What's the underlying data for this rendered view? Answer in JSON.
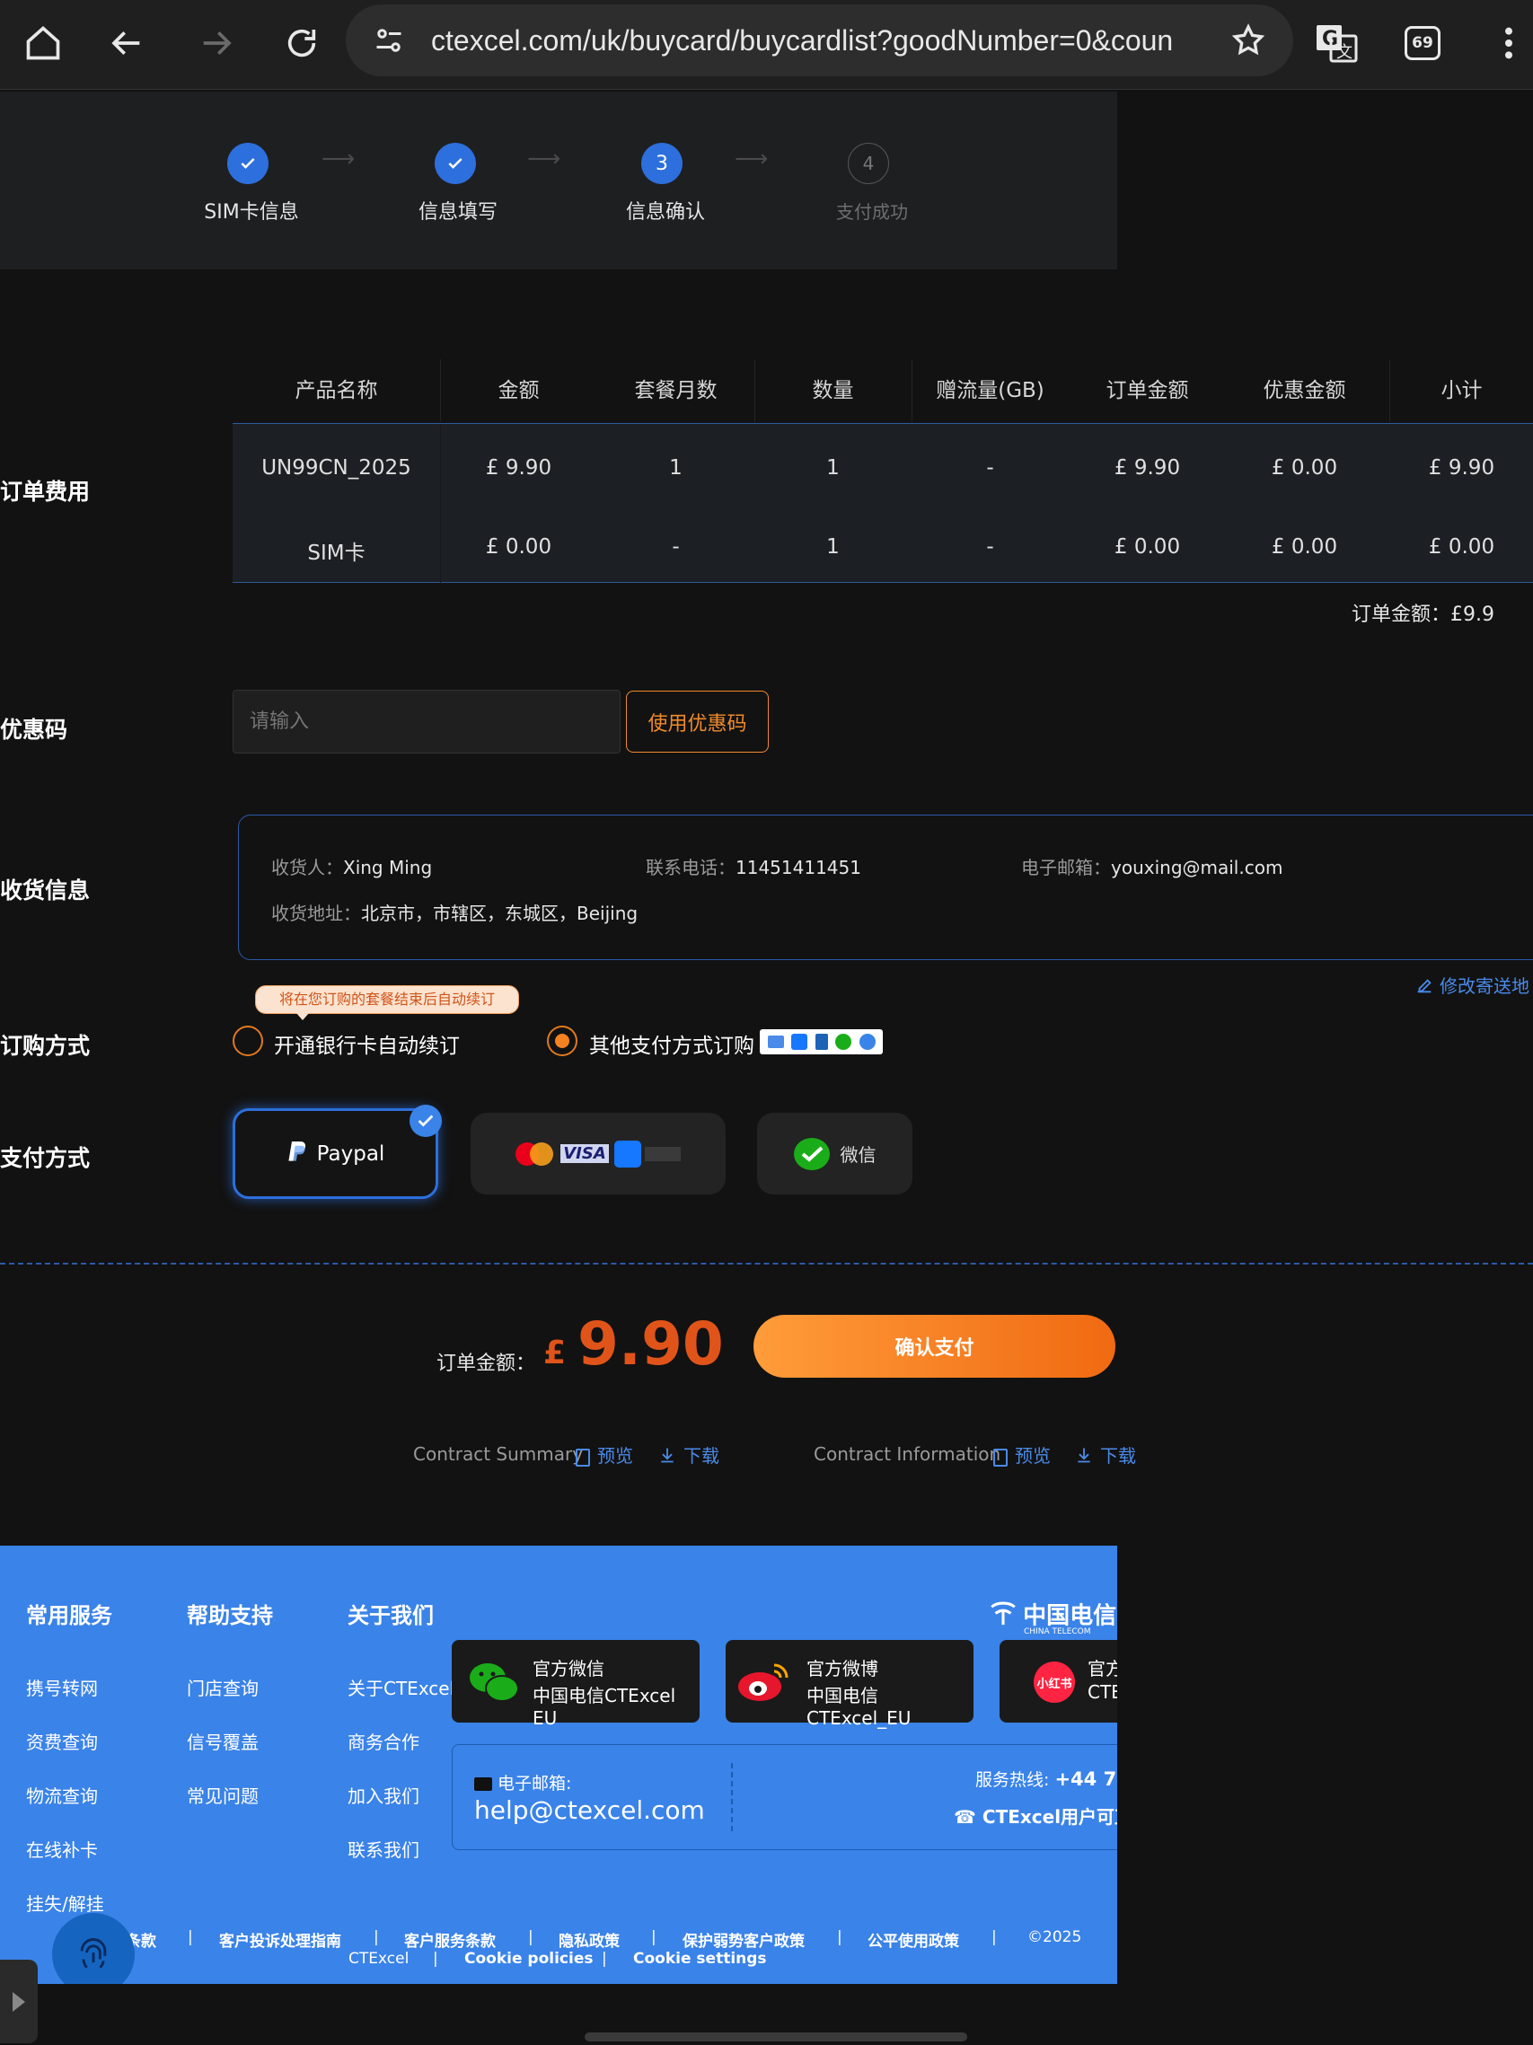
{
  "browser": {
    "url": "ctexcel.com/uk/buycard/buycardlist?goodNumber=0&coun",
    "tab_count": "69"
  },
  "steps": [
    {
      "label": "SIM卡信息",
      "state": "done",
      "num": ""
    },
    {
      "label": "信息填写",
      "state": "done",
      "num": ""
    },
    {
      "label": "信息确认",
      "state": "active",
      "num": "3"
    },
    {
      "label": "支付成功",
      "state": "todo",
      "num": "4"
    }
  ],
  "order": {
    "section_label": "订单费用",
    "headers": [
      "产品名称",
      "金额",
      "套餐月数",
      "数量",
      "赠流量(GB)",
      "订单金额",
      "优惠金额",
      "小计"
    ],
    "rows": [
      [
        "UN99CN_2025",
        "£ 9.90",
        "1",
        "1",
        "-",
        "£ 9.90",
        "£ 0.00",
        "£ 9.90"
      ],
      [
        "SIM卡",
        "£ 0.00",
        "-",
        "1",
        "-",
        "£ 0.00",
        "£ 0.00",
        "£ 0.00"
      ]
    ],
    "total_text": "订单金额：£9.9"
  },
  "coupon": {
    "section_label": "优惠码",
    "placeholder": "请输入",
    "button": "使用优惠码"
  },
  "shipping": {
    "section_label": "收货信息",
    "recipient_label": "收货人：",
    "recipient": "Xing Ming",
    "phone_label": "联系电话：",
    "phone": "11451411451",
    "email_label": "电子邮箱：",
    "email": "youxing@mail.com",
    "address_label": "收货地址：",
    "address": "北京市，市辖区，东城区，Beijing",
    "edit_link": "修改寄送地"
  },
  "subscription": {
    "section_label": "订购方式",
    "tooltip": "将在您订购的套餐结束后自动续订",
    "option1": "开通银行卡自动续订",
    "option2": "其他支付方式订购",
    "selected": "option2"
  },
  "payment": {
    "section_label": "支付方式",
    "methods": [
      "Paypal",
      "card",
      "微信"
    ],
    "selected": "Paypal",
    "mastercard": "MasterCard",
    "visa": "VISA"
  },
  "summary": {
    "total_label": "订单金额：",
    "currency": "£",
    "amount": "9.90",
    "confirm": "确认支付",
    "contract_summary": "Contract Summary",
    "contract_info": "Contract Information",
    "preview": "预览",
    "download": "下载"
  },
  "footer": {
    "col1_title": "常用服务",
    "col1_items": [
      "携号转网",
      "资费查询",
      "物流查询",
      "在线补卡",
      "挂失/解挂"
    ],
    "col2_title": "帮助支持",
    "col2_items": [
      "门店查询",
      "信号覆盖",
      "常见问题"
    ],
    "col3_title": "关于我们",
    "col3_items": [
      "关于CTExcel",
      "商务合作",
      "加入我们",
      "联系我们"
    ],
    "logo": "中国电信",
    "logo_sub": "CHINA TELECOM",
    "wechat_title": "官方微信",
    "wechat_name": "中国电信CTExcel EU",
    "weibo_title": "官方微博",
    "weibo_name": "中国电信CTExcel_EU",
    "xhs_title": "官方",
    "xhs_name": "CTE",
    "xhs_badge": "小红书",
    "email_label": "电子邮箱:",
    "email": "help@ctexcel.com",
    "hotline_label": "服务热线:",
    "hotline": "+44 7",
    "hotline_note": "CTExcel用户可直",
    "links": [
      "条款",
      "客户投诉处理指南",
      "客户服务条款",
      "隐私政策",
      "保护弱势客户政策",
      "公平使用政策"
    ],
    "copyright": "©2025",
    "brand": "CTExcel",
    "cookie_policies": "Cookie policies",
    "cookie_settings": "Cookie settings"
  },
  "colors": {
    "accent_blue": "#2d6fdc",
    "orange": "#f58220",
    "footer_blue": "#3a83e8",
    "price_red": "#e0541a"
  }
}
